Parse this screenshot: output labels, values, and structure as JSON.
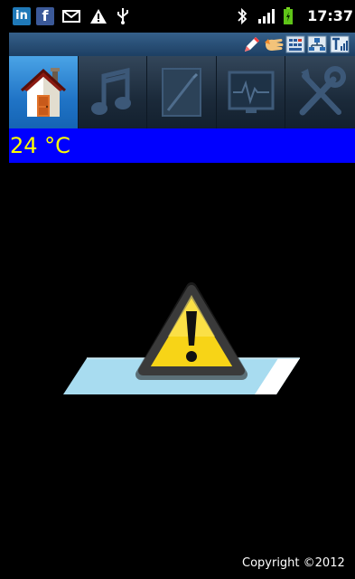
{
  "status_bar": {
    "linkedin_icon_text": "in",
    "facebook_icon_text": "f",
    "time": "17:37",
    "icons": [
      "linkedin-icon",
      "facebook-icon",
      "mail-icon",
      "warning-icon",
      "usb-icon",
      "bluetooth-icon",
      "signal-icon",
      "battery-icon"
    ]
  },
  "notification_strip": {
    "icons": [
      "edit-icon",
      "hand-icon",
      "keypad-icon",
      "network-icon",
      "signal-t-icon"
    ]
  },
  "tabs": [
    {
      "icon": "home-icon",
      "active": true
    },
    {
      "icon": "music-icon",
      "active": false
    },
    {
      "icon": "note-icon",
      "active": false
    },
    {
      "icon": "monitor-icon",
      "active": false
    },
    {
      "icon": "tools-icon",
      "active": false
    }
  ],
  "temperature": {
    "value": "24 °C",
    "text_color": "#ffff00",
    "background_color": "#0000ff"
  },
  "main": {
    "illustration": "warning-sign-over-test-strip",
    "copyright": "Copyright ©2012"
  },
  "colors": {
    "active_tab": "#2f86d6",
    "warning_yellow": "#f7d417",
    "strip_blue": "#a8dcf0"
  }
}
